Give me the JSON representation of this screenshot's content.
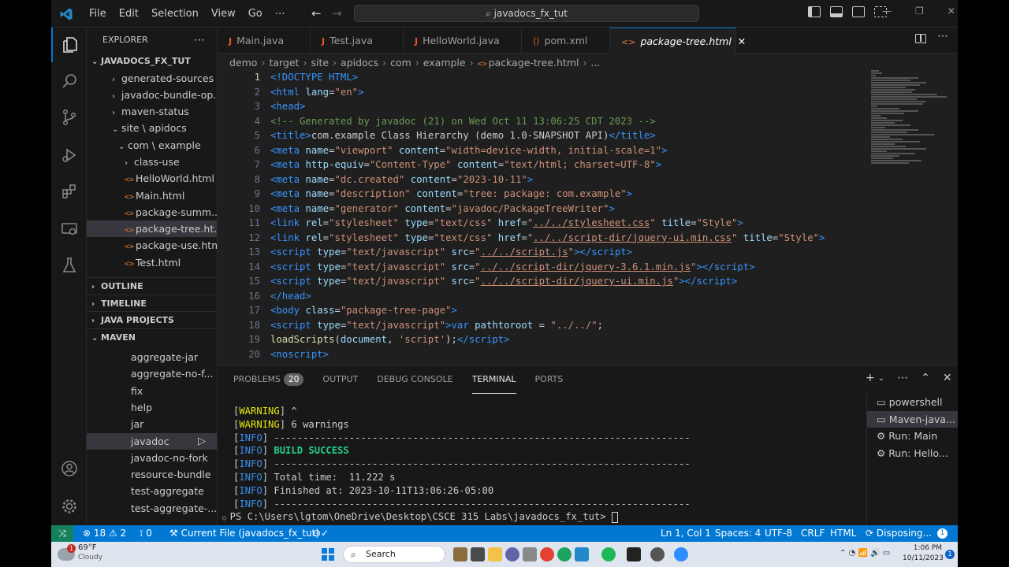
{
  "titlebar": {
    "menus": [
      "File",
      "Edit",
      "Selection",
      "View",
      "Go",
      "⋯"
    ],
    "search_text": "javadocs_fx_tut"
  },
  "explorer": {
    "title": "EXPLORER",
    "root": "JAVADOCS_FX_TUT",
    "items": [
      {
        "label": "generated-sources",
        "kind": "folder",
        "chev": "›"
      },
      {
        "label": "javadoc-bundle-op...",
        "kind": "folder",
        "chev": "›"
      },
      {
        "label": "maven-status",
        "kind": "folder",
        "chev": "›"
      },
      {
        "label": "site \\ apidocs",
        "kind": "folder",
        "chev": "⌄"
      },
      {
        "label": "com \\ example",
        "kind": "folder",
        "chev": "⌄"
      },
      {
        "label": "class-use",
        "kind": "folder",
        "chev": "›"
      },
      {
        "label": "HelloWorld.html",
        "kind": "html"
      },
      {
        "label": "Main.html",
        "kind": "html"
      },
      {
        "label": "package-summ...",
        "kind": "html"
      },
      {
        "label": "package-tree.ht...",
        "kind": "html",
        "selected": true
      },
      {
        "label": "package-use.html",
        "kind": "html"
      },
      {
        "label": "Test.html",
        "kind": "html"
      }
    ],
    "sections": [
      "OUTLINE",
      "TIMELINE",
      "JAVA PROJECTS",
      "MAVEN"
    ],
    "maven_items": [
      "aggregate-jar",
      "aggregate-no-f...",
      "fix",
      "help",
      "jar",
      "javadoc",
      "javadoc-no-fork",
      "resource-bundle",
      "test-aggregate",
      "test-aggregate-..."
    ],
    "maven_selected": "javadoc"
  },
  "tabs": [
    {
      "label": "Main.java",
      "icon": "J"
    },
    {
      "label": "Test.java",
      "icon": "J"
    },
    {
      "label": "HelloWorld.java",
      "icon": "J"
    },
    {
      "label": "pom.xml",
      "icon": "xml"
    },
    {
      "label": "package-tree.html",
      "icon": "<>",
      "active": true,
      "close": "✕"
    }
  ],
  "breadcrumb": [
    "demo",
    "target",
    "site",
    "apidocs",
    "com",
    "example",
    "package-tree.html",
    "..."
  ],
  "code_lines": [
    "1",
    "2",
    "3",
    "4",
    "5",
    "6",
    "7",
    "8",
    "9",
    "10",
    "11",
    "12",
    "13",
    "14",
    "15",
    "16",
    "17",
    "18",
    "19",
    "20"
  ],
  "panel": {
    "tabs": [
      "PROBLEMS",
      "OUTPUT",
      "DEBUG CONSOLE",
      "TERMINAL",
      "PORTS"
    ],
    "problems_count": "20",
    "active_tab": "TERMINAL",
    "terminal_lines": [
      {
        "tag": "WARNING",
        "text": " ^"
      },
      {
        "tag": "WARNING",
        "text": " 6 warnings"
      },
      {
        "tag": "INFO",
        "text": " ------------------------------------------------------------------------"
      },
      {
        "tag": "INFO",
        "text": " BUILD SUCCESS",
        "style": "success"
      },
      {
        "tag": "INFO",
        "text": " ------------------------------------------------------------------------"
      },
      {
        "tag": "INFO",
        "text": " Total time:  11.222 s"
      },
      {
        "tag": "INFO",
        "text": " Finished at: 2023-10-11T13:06:26-05:00"
      },
      {
        "tag": "INFO",
        "text": " ------------------------------------------------------------------------"
      }
    ],
    "prompt": "PS C:\\Users\\lgtom\\OneDrive\\Desktop\\CSCE 315 Labs\\javadocs_fx_tut> ",
    "terminals": [
      "powershell",
      "Maven-java...",
      "Run: Main",
      "Run: Hello..."
    ],
    "terminal_selected": "Maven-java..."
  },
  "statusbar": {
    "errors": "18",
    "warnings": "2",
    "ports": "0",
    "current_file": "Current File (javadocs_fx_tut)",
    "position": "Ln 1, Col 1",
    "spaces": "Spaces: 4",
    "encoding": "UTF-8",
    "eol": "CRLF",
    "language": "HTML",
    "task": "Disposing...",
    "notif": "1"
  },
  "taskbar": {
    "weather_temp": "69°F",
    "weather_desc": "Cloudy",
    "weather_badge": "1",
    "search": "Search",
    "time": "1:06 PM",
    "date": "10/11/2023",
    "notif": "1"
  },
  "colors": {
    "accent": "#0078d4",
    "tag": "#3794ff",
    "attr": "#9cdcfe",
    "string": "#ce9178",
    "comment": "#6a9955"
  }
}
